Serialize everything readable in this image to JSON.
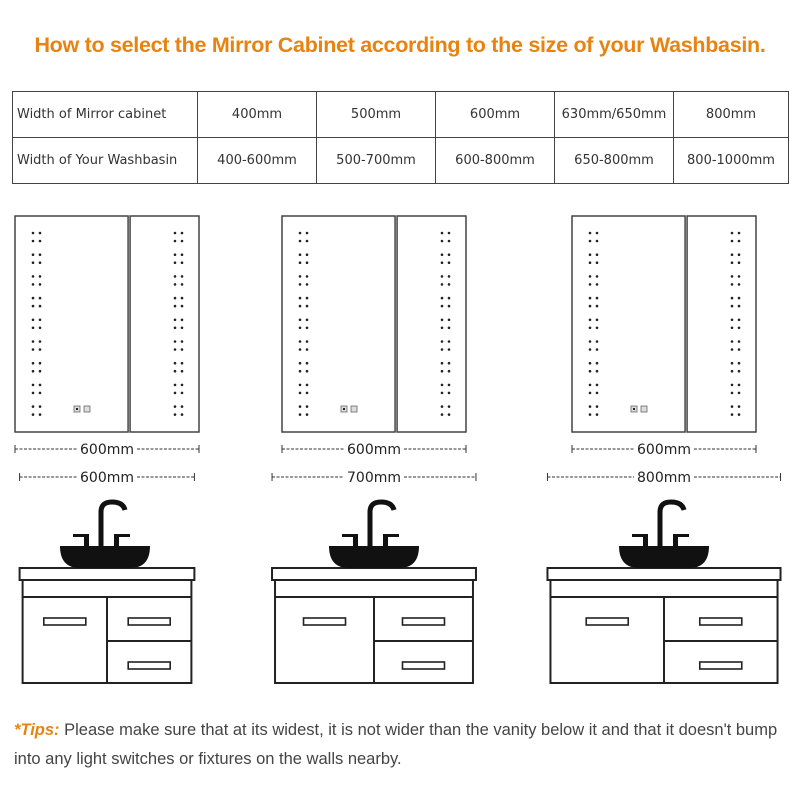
{
  "title": "How to select the Mirror Cabinet according to the size of your Washbasin.",
  "accent_color": "#e8830f",
  "size_table": {
    "rows": [
      {
        "header": "Width of Mirror cabinet",
        "cells": [
          "400mm",
          "500mm",
          "600mm",
          "630mm/650mm",
          "800mm"
        ]
      },
      {
        "header": "Width of Your Washbasin",
        "cells": [
          "400-600mm",
          "500-700mm",
          "600-800mm",
          "650-800mm",
          "800-1000mm"
        ]
      }
    ]
  },
  "examples": [
    {
      "mirror_label": "600mm",
      "vanity_label": "600mm",
      "mirror_width_mm": 600,
      "vanity_width_mm": 600
    },
    {
      "mirror_label": "600mm",
      "vanity_label": "700mm",
      "mirror_width_mm": 600,
      "vanity_width_mm": 700
    },
    {
      "mirror_label": "600mm",
      "vanity_label": "800mm",
      "mirror_width_mm": 600,
      "vanity_width_mm": 800
    }
  ],
  "icons": {
    "mirror": "mirror-cabinet-icon",
    "led_dots": "led-light-strip-icon",
    "touch_switch": "touch-switch-icon",
    "basin": "vessel-basin-icon",
    "faucet": "faucet-icon",
    "vanity": "vanity-cabinet-icon"
  },
  "tips": {
    "label": "*Tips:",
    "text": " Please make sure that at its widest, it is not wider than the vanity below it and that it doesn't bump into any light switches or fixtures on the walls nearby."
  }
}
